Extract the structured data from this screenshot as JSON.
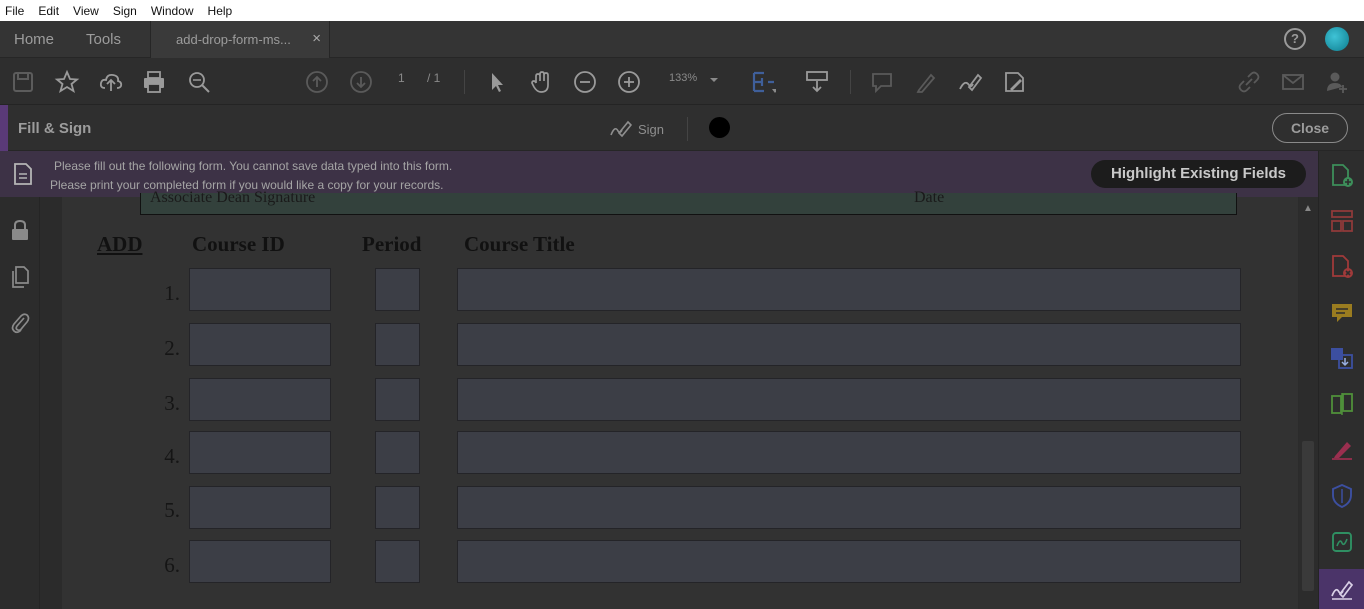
{
  "menu": [
    "File",
    "Edit",
    "View",
    "Sign",
    "Window",
    "Help"
  ],
  "tabs": {
    "home": "Home",
    "tools": "Tools",
    "document": "add-drop-form-ms...",
    "close_glyph": "×"
  },
  "help_glyph": "?",
  "toolbar": {
    "page_current": "1",
    "page_total": "/ 1",
    "zoom": "133%"
  },
  "fill_sign": {
    "title": "Fill & Sign",
    "sign_label": "Sign",
    "close_label": "Close"
  },
  "notice": {
    "line1": "Please fill out the following form. You cannot save data typed into this form.",
    "line2": "Please print your completed form if you would like a copy for your records.",
    "button": "Highlight Existing Fields"
  },
  "form": {
    "signature_label": "Associate Dean Signature",
    "date_label": "Date",
    "headers": {
      "add": "ADD",
      "course_id": "Course ID",
      "period": "Period",
      "course_title": "Course Title"
    },
    "rows": [
      "1.",
      "2.",
      "3.",
      "4.",
      "5.",
      "6."
    ]
  },
  "colors": {
    "accent": "#5a3a78",
    "notice_bg": "#3d3246",
    "field_bg": "#3c3e46"
  }
}
